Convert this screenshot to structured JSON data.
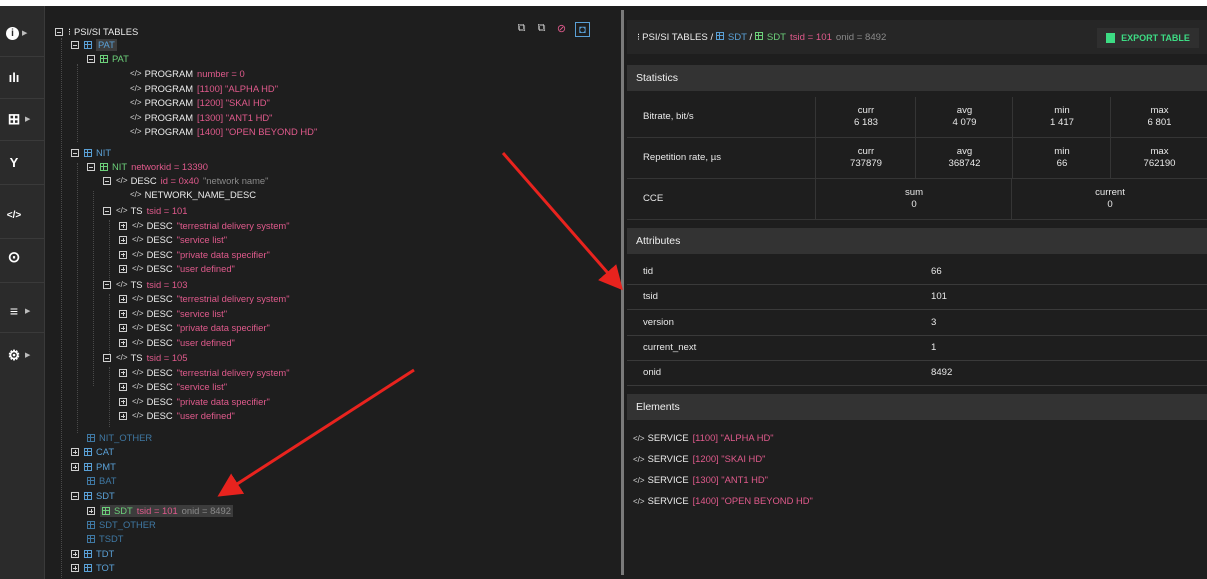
{
  "sidebar": {
    "items": [
      {
        "icon": "info-icon",
        "glyph": "i",
        "has_arrow": true
      },
      {
        "icon": "bitrate-chart-icon",
        "glyph": "ıl",
        "has_arrow": false
      },
      {
        "icon": "table-icon",
        "glyph": "⊞",
        "has_arrow": true
      },
      {
        "icon": "fork-icon",
        "glyph": "Y",
        "has_arrow": false
      },
      {
        "icon": "code-icon",
        "glyph": "</>",
        "has_arrow": false
      },
      {
        "icon": "record-icon",
        "glyph": "⊙",
        "has_arrow": false
      },
      {
        "icon": "list-icon",
        "glyph": "≡",
        "has_arrow": true
      },
      {
        "icon": "gear-icon",
        "glyph": "⚙",
        "has_arrow": true
      }
    ]
  },
  "tree": {
    "root_label": "PSI/SI TABLES",
    "pat": "PAT",
    "pat_inner": "PAT",
    "programs": [
      {
        "kw": "PROGRAM",
        "val": "number = 0"
      },
      {
        "kw": "PROGRAM",
        "val": "[1100] \"ALPHA HD\""
      },
      {
        "kw": "PROGRAM",
        "val": "[1200] \"SKAI HD\""
      },
      {
        "kw": "PROGRAM",
        "val": "[1300] \"ANT1 HD\""
      },
      {
        "kw": "PROGRAM",
        "val": "[1400] \"OPEN BEYOND HD\""
      }
    ],
    "nit": "NIT",
    "nit_inner": "NIT",
    "nit_val": "networkid = 13390",
    "desc_kw": "DESC",
    "desc_id": "id = 0x40",
    "desc_name": "\"network name\"",
    "network_name_desc": "NETWORK_NAME_DESC",
    "ts_groups": [
      {
        "kw": "TS",
        "val": "tsid = 101",
        "descs": [
          "\"terrestrial delivery system\"",
          "\"service list\"",
          "\"private data specifier\"",
          "\"user defined\""
        ]
      },
      {
        "kw": "TS",
        "val": "tsid = 103",
        "descs": [
          "\"terrestrial delivery system\"",
          "\"service list\"",
          "\"private data specifier\"",
          "\"user defined\""
        ]
      },
      {
        "kw": "TS",
        "val": "tsid = 105",
        "descs": [
          "\"terrestrial delivery system\"",
          "\"service list\"",
          "\"private data specifier\"",
          "\"user defined\""
        ]
      }
    ],
    "desc_label": "DESC",
    "nit_other": "NIT_OTHER",
    "cat": "CAT",
    "pmt": "PMT",
    "bat": "BAT",
    "sdt": "SDT",
    "sdt_child_kw": "SDT",
    "sdt_child_tsid": "tsid = 101",
    "sdt_child_onid": "onid = 8492",
    "sdt_other": "SDT_OTHER",
    "tsdt": "TSDT",
    "tdt": "TDT",
    "tot": "TOT"
  },
  "toolbar": {
    "icons": [
      "expand-all-icon",
      "collapse-all-icon",
      "filter-off-icon",
      "locate-icon"
    ]
  },
  "header": {
    "crumb_root": "PSI/SI TABLES",
    "crumb_sep1": " / ",
    "crumb_sdt": "SDT",
    "crumb_sep2": " / ",
    "crumb_sdt2": "SDT",
    "crumb_tsid": "tsid = 101",
    "crumb_onid": "onid = 8492",
    "export_label": "EXPORT TABLE"
  },
  "statistics": {
    "title": "Statistics",
    "bitrate": {
      "label": "Bitrate, bit/s",
      "curr_h": "curr",
      "curr": "6 183",
      "avg_h": "avg",
      "avg": "4 079",
      "min_h": "min",
      "min": "1 417",
      "max_h": "max",
      "max": "6 801"
    },
    "repetition": {
      "label": "Repetition rate, µs",
      "curr_h": "curr",
      "curr": "737879",
      "avg_h": "avg",
      "avg": "368742",
      "min_h": "min",
      "min": "66",
      "max_h": "max",
      "max": "762190"
    },
    "cce": {
      "label": "CCE",
      "sum_h": "sum",
      "sum": "0",
      "current_h": "current",
      "current": "0"
    }
  },
  "attributes": {
    "title": "Attributes",
    "rows": [
      {
        "k": "tid",
        "v": "66"
      },
      {
        "k": "tsid",
        "v": "101"
      },
      {
        "k": "version",
        "v": "3"
      },
      {
        "k": "current_next",
        "v": "1"
      },
      {
        "k": "onid",
        "v": "8492"
      }
    ]
  },
  "elements": {
    "title": "Elements",
    "items": [
      {
        "kw": "SERVICE",
        "val": "[1100] \"ALPHA HD\""
      },
      {
        "kw": "SERVICE",
        "val": "[1200] \"SKAI HD\""
      },
      {
        "kw": "SERVICE",
        "val": "[1300] \"ANT1 HD\""
      },
      {
        "kw": "SERVICE",
        "val": "[1400] \"OPEN BEYOND HD\""
      }
    ]
  },
  "colors": {
    "accent_green": "#3ddc84",
    "pink": "#e05a8c",
    "blue": "#5aa0d6",
    "arrow_red": "#e8231e"
  }
}
